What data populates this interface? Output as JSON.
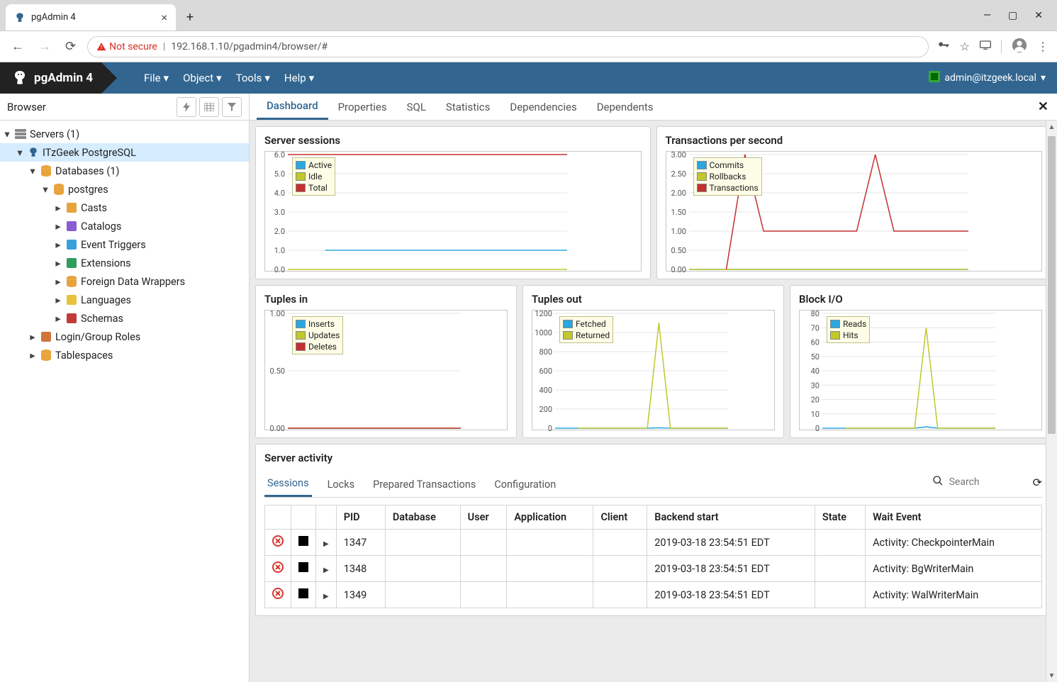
{
  "browser_tab": {
    "title": "pgAdmin 4"
  },
  "urlbar": {
    "insecure_label": "Not secure",
    "url": "192.168.1.10/pgadmin4/browser/#"
  },
  "app": {
    "brand": "pgAdmin 4",
    "menus": [
      "File",
      "Object",
      "Tools",
      "Help"
    ],
    "user": "admin@itzgeek.local"
  },
  "sidebar": {
    "title": "Browser",
    "tree": [
      {
        "depth": 0,
        "caret": "down",
        "icon": "server-group",
        "label": "Servers (1)",
        "selected": false
      },
      {
        "depth": 1,
        "caret": "down",
        "icon": "server",
        "label": "ITzGeek PostgreSQL",
        "selected": true
      },
      {
        "depth": 2,
        "caret": "down",
        "icon": "database-group",
        "label": "Databases (1)",
        "selected": false
      },
      {
        "depth": 3,
        "caret": "down",
        "icon": "database",
        "label": "postgres",
        "selected": false
      },
      {
        "depth": 4,
        "caret": "right",
        "icon": "casts",
        "label": "Casts",
        "selected": false
      },
      {
        "depth": 4,
        "caret": "right",
        "icon": "catalogs",
        "label": "Catalogs",
        "selected": false
      },
      {
        "depth": 4,
        "caret": "right",
        "icon": "event-triggers",
        "label": "Event Triggers",
        "selected": false
      },
      {
        "depth": 4,
        "caret": "right",
        "icon": "extensions",
        "label": "Extensions",
        "selected": false
      },
      {
        "depth": 4,
        "caret": "right",
        "icon": "fdw",
        "label": "Foreign Data Wrappers",
        "selected": false
      },
      {
        "depth": 4,
        "caret": "right",
        "icon": "languages",
        "label": "Languages",
        "selected": false
      },
      {
        "depth": 4,
        "caret": "right",
        "icon": "schemas",
        "label": "Schemas",
        "selected": false
      },
      {
        "depth": 2,
        "caret": "right",
        "icon": "login-roles",
        "label": "Login/Group Roles",
        "selected": false
      },
      {
        "depth": 2,
        "caret": "right",
        "icon": "tablespaces",
        "label": "Tablespaces",
        "selected": false
      }
    ]
  },
  "tabs": [
    "Dashboard",
    "Properties",
    "SQL",
    "Statistics",
    "Dependencies",
    "Dependents"
  ],
  "active_tab": "Dashboard",
  "charts": {
    "sessions": {
      "title": "Server sessions",
      "legend": [
        {
          "label": "Active",
          "color": "#2aa7e0"
        },
        {
          "label": "Idle",
          "color": "#c0c82a"
        },
        {
          "label": "Total",
          "color": "#c43030"
        }
      ]
    },
    "tps": {
      "title": "Transactions per second",
      "legend": [
        {
          "label": "Commits",
          "color": "#2aa7e0"
        },
        {
          "label": "Rollbacks",
          "color": "#c0c82a"
        },
        {
          "label": "Transactions",
          "color": "#c43030"
        }
      ]
    },
    "tin": {
      "title": "Tuples in",
      "legend": [
        {
          "label": "Inserts",
          "color": "#2aa7e0"
        },
        {
          "label": "Updates",
          "color": "#c0c82a"
        },
        {
          "label": "Deletes",
          "color": "#c43030"
        }
      ]
    },
    "tout": {
      "title": "Tuples out",
      "legend": [
        {
          "label": "Fetched",
          "color": "#2aa7e0"
        },
        {
          "label": "Returned",
          "color": "#c0c82a"
        }
      ]
    },
    "bio": {
      "title": "Block I/O",
      "legend": [
        {
          "label": "Reads",
          "color": "#2aa7e0"
        },
        {
          "label": "Hits",
          "color": "#c0c82a"
        }
      ]
    }
  },
  "chart_data": [
    {
      "id": "sessions",
      "type": "line",
      "ylim": [
        0,
        6
      ],
      "yticks": [
        "0.0",
        "1.0",
        "2.0",
        "3.0",
        "4.0",
        "5.0",
        "6.0"
      ],
      "series": [
        {
          "name": "Active",
          "color": "#2aa7e0",
          "values": [
            null,
            null,
            1,
            1,
            1,
            1,
            1,
            1,
            1,
            1,
            1,
            1,
            1,
            1,
            1,
            1
          ]
        },
        {
          "name": "Idle",
          "color": "#c0c82a",
          "values": [
            0,
            0,
            0,
            0,
            0,
            0,
            0,
            0,
            0,
            0,
            0,
            0,
            0,
            0,
            0,
            0
          ]
        },
        {
          "name": "Total",
          "color": "#c43030",
          "values": [
            6,
            6,
            6,
            6,
            6,
            6,
            6,
            6,
            6,
            6,
            6,
            6,
            6,
            6,
            6,
            6
          ]
        }
      ]
    },
    {
      "id": "tps",
      "type": "line",
      "ylim": [
        0,
        3
      ],
      "yticks": [
        "0.00",
        "0.50",
        "1.00",
        "1.50",
        "2.00",
        "2.50",
        "3.00"
      ],
      "series": [
        {
          "name": "Commits",
          "color": "#2aa7e0",
          "values": [
            0,
            0,
            0,
            0,
            0,
            0,
            0,
            0,
            0,
            0,
            0,
            0,
            0,
            0,
            0,
            0
          ]
        },
        {
          "name": "Rollbacks",
          "color": "#c0c82a",
          "values": [
            0,
            0,
            0,
            0,
            0,
            0,
            0,
            0,
            0,
            0,
            0,
            0,
            0,
            0,
            0,
            0
          ]
        },
        {
          "name": "Transactions",
          "color": "#c43030",
          "values": [
            null,
            null,
            0,
            3,
            1,
            1,
            1,
            1,
            1,
            1,
            3,
            1,
            1,
            1,
            1,
            1
          ]
        }
      ]
    },
    {
      "id": "tin",
      "type": "line",
      "ylim": [
        0,
        1
      ],
      "yticks": [
        "0.00",
        "0.50",
        "1.00"
      ],
      "series": [
        {
          "name": "Inserts",
          "color": "#2aa7e0",
          "values": [
            0,
            0,
            0,
            0,
            0,
            0,
            0,
            0,
            0,
            0,
            0,
            0,
            0,
            0,
            0,
            0
          ]
        },
        {
          "name": "Updates",
          "color": "#c0c82a",
          "values": [
            0,
            0,
            0,
            0,
            0,
            0,
            0,
            0,
            0,
            0,
            0,
            0,
            0,
            0,
            0,
            0
          ]
        },
        {
          "name": "Deletes",
          "color": "#c43030",
          "values": [
            0,
            0,
            0,
            0,
            0,
            0,
            0,
            0,
            0,
            0,
            0,
            0,
            0,
            0,
            0,
            0
          ]
        }
      ]
    },
    {
      "id": "tout",
      "type": "line",
      "ylim": [
        0,
        1200
      ],
      "yticks": [
        "0",
        "200",
        "400",
        "600",
        "800",
        "1000",
        "1200"
      ],
      "series": [
        {
          "name": "Fetched",
          "color": "#2aa7e0",
          "values": [
            0,
            0,
            0,
            0,
            0,
            0,
            0,
            0,
            0,
            5,
            0,
            0,
            0,
            0,
            0,
            0
          ]
        },
        {
          "name": "Returned",
          "color": "#c0c82a",
          "values": [
            null,
            null,
            0,
            0,
            0,
            0,
            0,
            0,
            0,
            1100,
            0,
            0,
            0,
            0,
            0,
            0
          ]
        }
      ]
    },
    {
      "id": "bio",
      "type": "line",
      "ylim": [
        0,
        80
      ],
      "yticks": [
        "0",
        "10",
        "20",
        "30",
        "40",
        "50",
        "60",
        "70",
        "80"
      ],
      "series": [
        {
          "name": "Reads",
          "color": "#2aa7e0",
          "values": [
            0,
            0,
            0,
            0,
            0,
            0,
            0,
            0,
            0,
            1,
            0,
            0,
            0,
            0,
            0,
            0
          ]
        },
        {
          "name": "Hits",
          "color": "#c0c82a",
          "values": [
            null,
            null,
            0,
            0,
            0,
            0,
            0,
            0,
            0,
            70,
            0,
            0,
            0,
            0,
            0,
            0
          ]
        }
      ]
    }
  ],
  "activity": {
    "title": "Server activity",
    "subtabs": [
      "Sessions",
      "Locks",
      "Prepared Transactions",
      "Configuration"
    ],
    "active_subtab": "Sessions",
    "search_placeholder": "Search",
    "columns": [
      "PID",
      "Database",
      "User",
      "Application",
      "Client",
      "Backend start",
      "State",
      "Wait Event"
    ],
    "rows": [
      {
        "pid": "1347",
        "database": "",
        "user": "",
        "application": "",
        "client": "",
        "backend_start": "2019-03-18 23:54:51 EDT",
        "state": "",
        "wait_event": "Activity: CheckpointerMain"
      },
      {
        "pid": "1348",
        "database": "",
        "user": "",
        "application": "",
        "client": "",
        "backend_start": "2019-03-18 23:54:51 EDT",
        "state": "",
        "wait_event": "Activity: BgWriterMain"
      },
      {
        "pid": "1349",
        "database": "",
        "user": "",
        "application": "",
        "client": "",
        "backend_start": "2019-03-18 23:54:51 EDT",
        "state": "",
        "wait_event": "Activity: WalWriterMain"
      }
    ]
  }
}
